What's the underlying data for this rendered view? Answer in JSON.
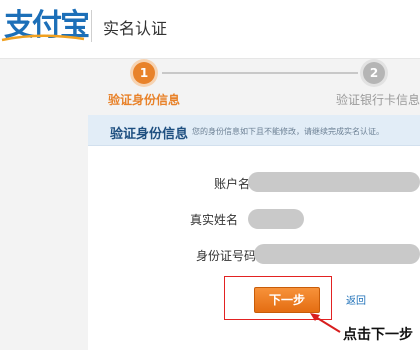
{
  "header": {
    "logo_text": "支付宝",
    "page_title": "实名认证"
  },
  "stepper": {
    "steps": [
      {
        "number": "1",
        "label": "验证身份信息",
        "state": "active"
      },
      {
        "number": "2",
        "label": "验证银行卡信息",
        "state": "inactive"
      }
    ]
  },
  "panel": {
    "title": "验证身份信息",
    "description": "您的身份信息如下且不能修改，请继续完成实名认证。",
    "fields": [
      {
        "label": "账户名"
      },
      {
        "label": "真实姓名"
      },
      {
        "label": "身份证号码"
      }
    ]
  },
  "actions": {
    "next_label": "下一步",
    "back_label": "返回"
  },
  "annotation": {
    "text": "点击下一步"
  },
  "colors": {
    "accent": "#e8822a",
    "brand": "#1c6fb8",
    "highlight": "#e22222"
  }
}
